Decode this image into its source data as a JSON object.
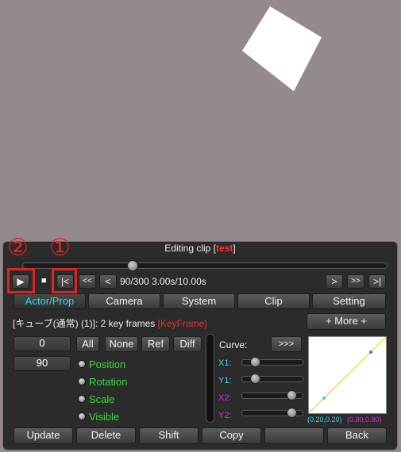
{
  "window": {
    "title_prefix": "Editing clip [",
    "clip_name": "test",
    "title_suffix": "]"
  },
  "timeline": {
    "position": 0.3
  },
  "transport": {
    "play": "▶",
    "stop": "■",
    "to_start": "|<",
    "rewind": "<<",
    "step_back": "<",
    "frame_readout": "90/300 3.00s/10.00s",
    "step_forward": ">",
    "fast_forward": ">>",
    "to_end": ">|"
  },
  "tabs": [
    "Actor/Prop",
    "Camera",
    "System",
    "Clip",
    "Setting"
  ],
  "selection": {
    "info": "[キューブ(通常)  (1)]: 2 key frames",
    "keyframe_tag": "[KeyFrame]",
    "more_button": "+ More +"
  },
  "frame_fields": {
    "start": "0",
    "current": "90"
  },
  "filter_buttons": [
    "All",
    "None",
    "Ref",
    "Diff"
  ],
  "properties": [
    "Position",
    "Rotation",
    "Scale",
    "Visible"
  ],
  "curve": {
    "label": "Curve:",
    "expand": ">>>",
    "params": [
      {
        "name": "X1:",
        "value": 0.2
      },
      {
        "name": "Y1:",
        "value": 0.2
      },
      {
        "name": "X2:",
        "value": 0.8
      },
      {
        "name": "Y2:",
        "value": 0.8
      }
    ],
    "point1_label": "(0.20,0.20)",
    "point2_label": "(0.80,0.80)"
  },
  "actions": [
    "Update",
    "Delete",
    "Shift",
    "Copy",
    "",
    "Back"
  ],
  "annotations": {
    "marker1": "①",
    "marker2": "②"
  },
  "colors": {
    "accent_cyan": "#35d6e8",
    "highlight_red": "#e62020",
    "property_green": "#33dd33",
    "curve_magenta": "#d02fd0"
  }
}
